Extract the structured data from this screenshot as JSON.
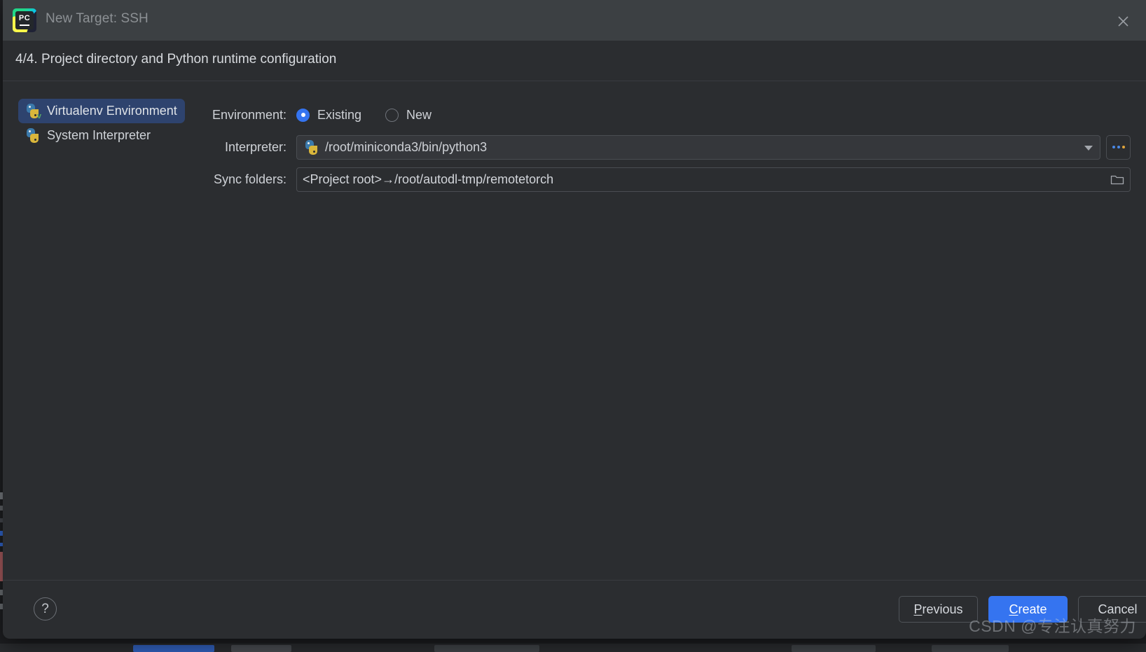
{
  "window": {
    "title": "New Target: SSH",
    "app_icon": "pycharm-logo",
    "close_icon": "close-icon"
  },
  "step": {
    "title": "4/4. Project directory and Python runtime configuration"
  },
  "sidebar": {
    "items": [
      {
        "label": "Virtualenv Environment",
        "icon": "python-venv-icon",
        "selected": true
      },
      {
        "label": "System Interpreter",
        "icon": "python-icon",
        "selected": false
      }
    ]
  },
  "form": {
    "environment": {
      "label": "Environment:",
      "options": [
        {
          "label": "Existing",
          "selected": true
        },
        {
          "label": "New",
          "selected": false
        }
      ]
    },
    "interpreter": {
      "label": "Interpreter:",
      "value": "/root/miniconda3/bin/python3",
      "icon": "python-icon",
      "dropdown_icon": "chevron-down-icon",
      "browse_label": "...",
      "browse_icon": "ellipsis-icon"
    },
    "sync_folders": {
      "label": "Sync folders:",
      "value": "<Project root>→/root/autodl-tmp/remotetorch",
      "browse_icon": "folder-icon"
    }
  },
  "footer": {
    "help_label": "?",
    "help_icon": "help-icon",
    "buttons": [
      {
        "name": "previous",
        "prefix": "",
        "mnemonic": "P",
        "rest": "revious",
        "primary": false
      },
      {
        "name": "create",
        "prefix": "",
        "mnemonic": "C",
        "rest": "reate",
        "primary": true
      },
      {
        "name": "cancel",
        "prefix": "Cancel",
        "mnemonic": "",
        "rest": "",
        "primary": false
      }
    ]
  },
  "watermark": {
    "text": "CSDN @专注认真努力"
  },
  "colors": {
    "accent": "#3574f0",
    "titlebar": "#3c4043",
    "dialog_bg": "#2b2d30",
    "selection": "#2e436e",
    "desktop_bg": "#1e1f22"
  }
}
